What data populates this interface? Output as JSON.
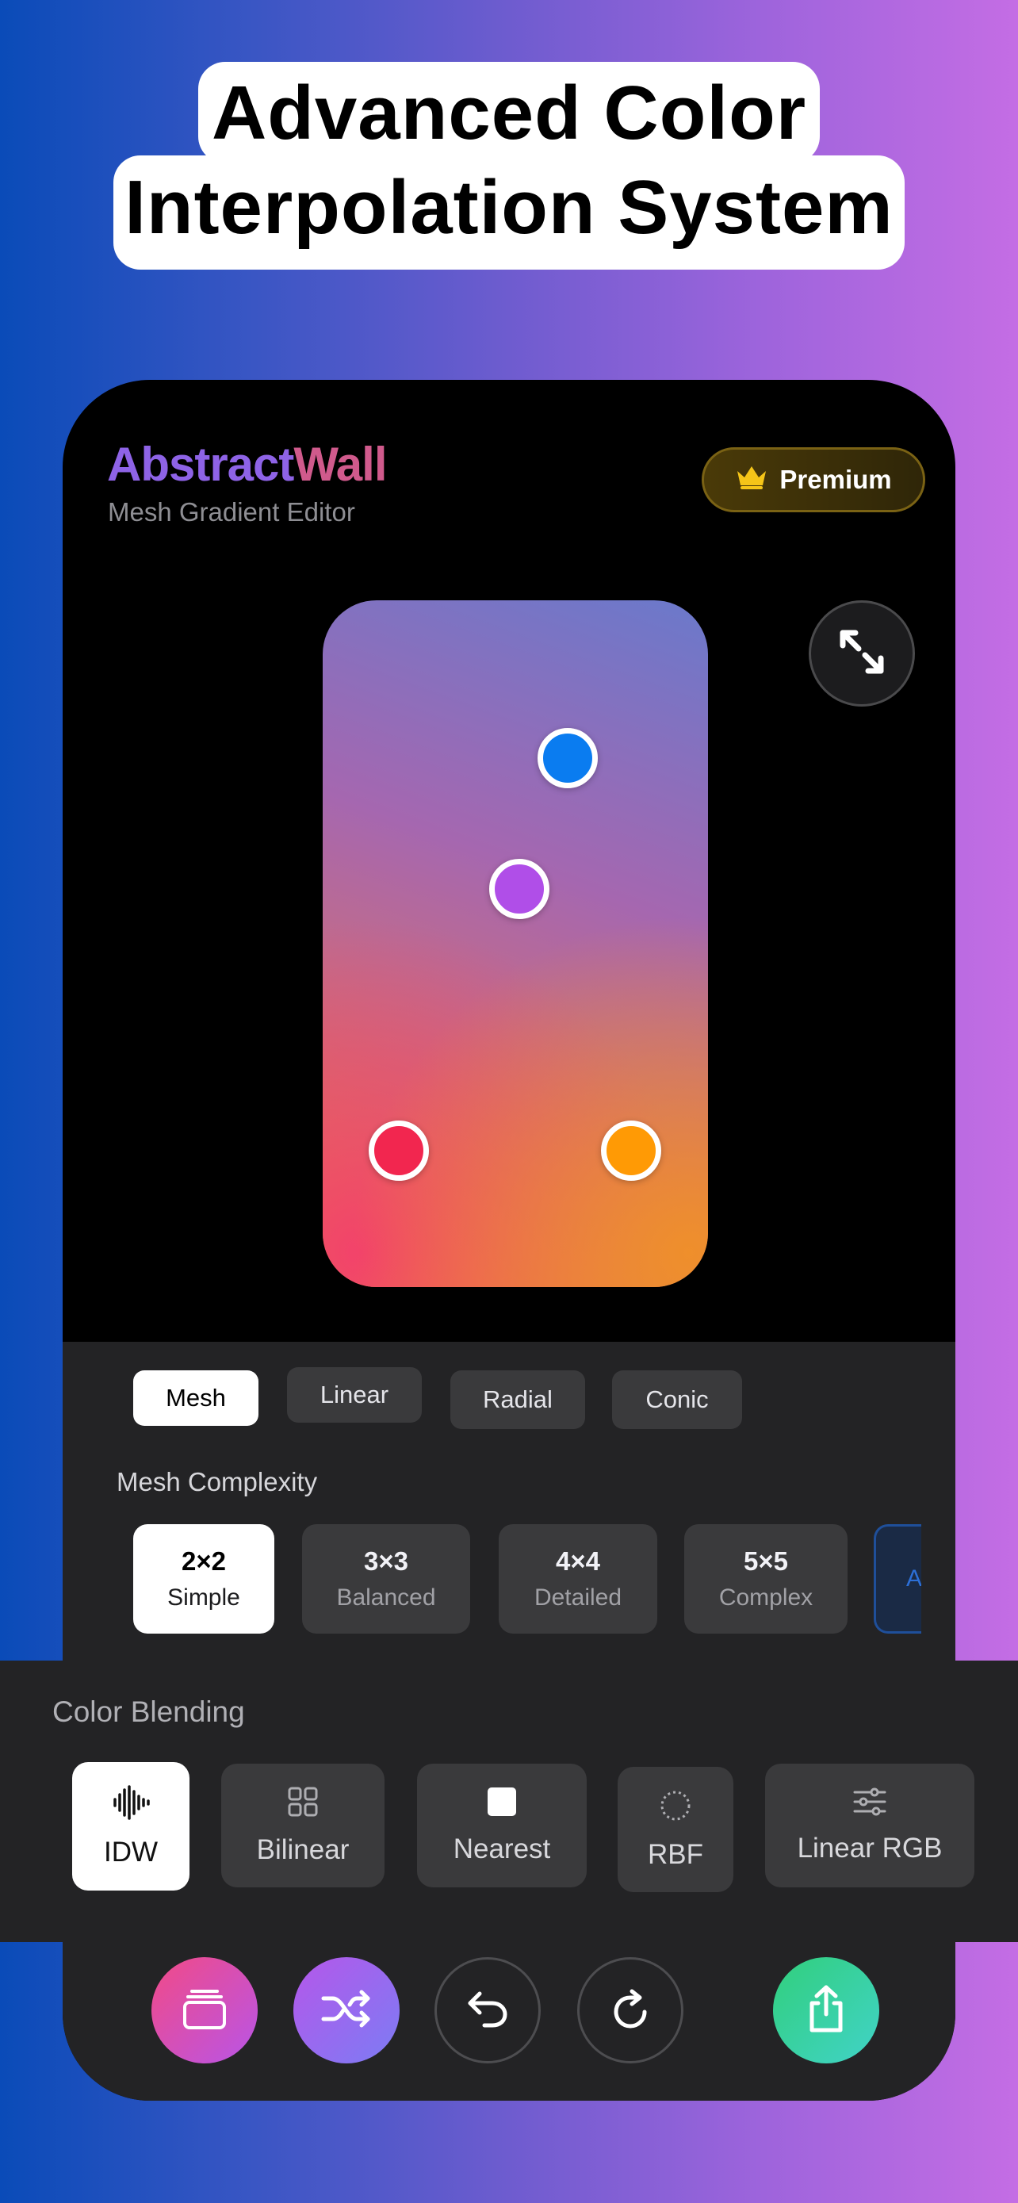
{
  "headline": {
    "line1": "Advanced Color",
    "line2": "Interpolation System"
  },
  "app": {
    "brand_parts": [
      "Abstract",
      "Wall"
    ],
    "subtitle": "Mesh Gradient Editor",
    "premium_label": "Premium"
  },
  "canvas": {
    "control_points": [
      {
        "name": "blue",
        "color": "#0a7cf0"
      },
      {
        "name": "purple",
        "color": "#b04ee8"
      },
      {
        "name": "pink",
        "color": "#f2264f"
      },
      {
        "name": "orange",
        "color": "#ff9a05"
      }
    ]
  },
  "gradient_tabs": [
    {
      "label": "Mesh",
      "active": true
    },
    {
      "label": "Linear",
      "active": false
    },
    {
      "label": "Radial",
      "active": false
    },
    {
      "label": "Conic",
      "active": false
    }
  ],
  "mesh_complexity": {
    "label": "Mesh Complexity",
    "options": [
      {
        "title": "2×2",
        "subtitle": "Simple",
        "active": true
      },
      {
        "title": "3×3",
        "subtitle": "Balanced",
        "active": false
      },
      {
        "title": "4×4",
        "subtitle": "Detailed",
        "active": false
      },
      {
        "title": "5×5",
        "subtitle": "Complex",
        "active": false
      }
    ],
    "partial_label": "A"
  },
  "color_blending": {
    "label": "Color Blending",
    "options": [
      {
        "label": "IDW",
        "icon": "waveform-icon",
        "active": true
      },
      {
        "label": "Bilinear",
        "icon": "grid-icon",
        "active": false
      },
      {
        "label": "Nearest",
        "icon": "square-icon",
        "active": false
      },
      {
        "label": "RBF",
        "icon": "dotted-circle-icon",
        "active": false
      },
      {
        "label": "Linear RGB",
        "icon": "sliders-icon",
        "active": false
      }
    ]
  },
  "toolbar": {
    "buttons": [
      "layers-icon",
      "shuffle-icon",
      "undo-icon",
      "redo-icon",
      "share-icon"
    ]
  },
  "colors": {
    "accent_pink": "#ee4ea0",
    "accent_purple": "#9b6cf0",
    "accent_green": "#2fd59a",
    "premium_gold": "#f5c518"
  }
}
